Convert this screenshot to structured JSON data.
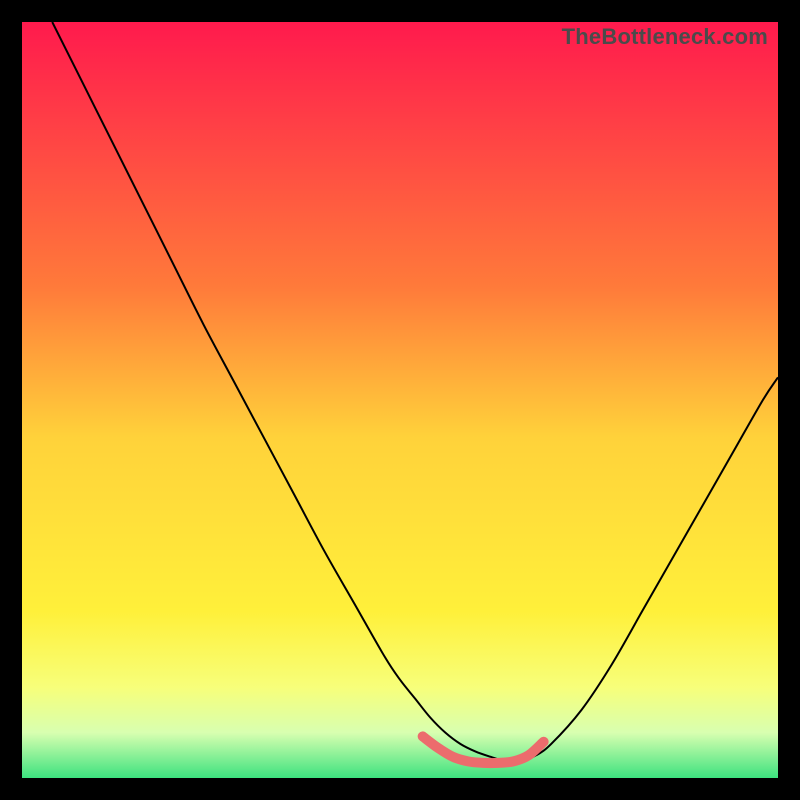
{
  "watermark": "TheBottleneck.com",
  "chart_data": {
    "type": "line",
    "title": "",
    "xlabel": "",
    "ylabel": "",
    "xlim": [
      0,
      100
    ],
    "ylim": [
      0,
      100
    ],
    "grid": false,
    "background_gradient": {
      "stops": [
        {
          "offset": 0.0,
          "color": "#ff1a4d"
        },
        {
          "offset": 0.35,
          "color": "#ff7a3a"
        },
        {
          "offset": 0.55,
          "color": "#ffd23a"
        },
        {
          "offset": 0.78,
          "color": "#fff03a"
        },
        {
          "offset": 0.88,
          "color": "#f7ff7a"
        },
        {
          "offset": 0.94,
          "color": "#d8ffb0"
        },
        {
          "offset": 1.0,
          "color": "#3de27f"
        }
      ]
    },
    "series": [
      {
        "name": "bottleneck-curve",
        "color": "#000000",
        "width": 2.0,
        "x": [
          4,
          8,
          12,
          16,
          20,
          24,
          28,
          32,
          36,
          40,
          44,
          48,
          50,
          52,
          54,
          56,
          58,
          60,
          62,
          64,
          66,
          68,
          70,
          74,
          78,
          82,
          86,
          90,
          94,
          98,
          100
        ],
        "y": [
          100,
          92,
          84,
          76,
          68,
          60,
          52.5,
          45,
          37.5,
          30,
          23,
          16,
          13,
          10.5,
          8,
          6,
          4.5,
          3.5,
          2.8,
          2.2,
          2.2,
          3,
          4.5,
          9,
          15,
          22,
          29,
          36,
          43,
          50,
          53
        ]
      },
      {
        "name": "optimal-flat-region",
        "color": "#ec6c6d",
        "width": 10,
        "linecap": "round",
        "x": [
          53,
          55,
          57,
          59,
          61,
          63,
          65,
          67,
          69
        ],
        "y": [
          5.5,
          4.0,
          2.8,
          2.2,
          2.0,
          2.0,
          2.2,
          3.0,
          4.8
        ]
      }
    ]
  }
}
